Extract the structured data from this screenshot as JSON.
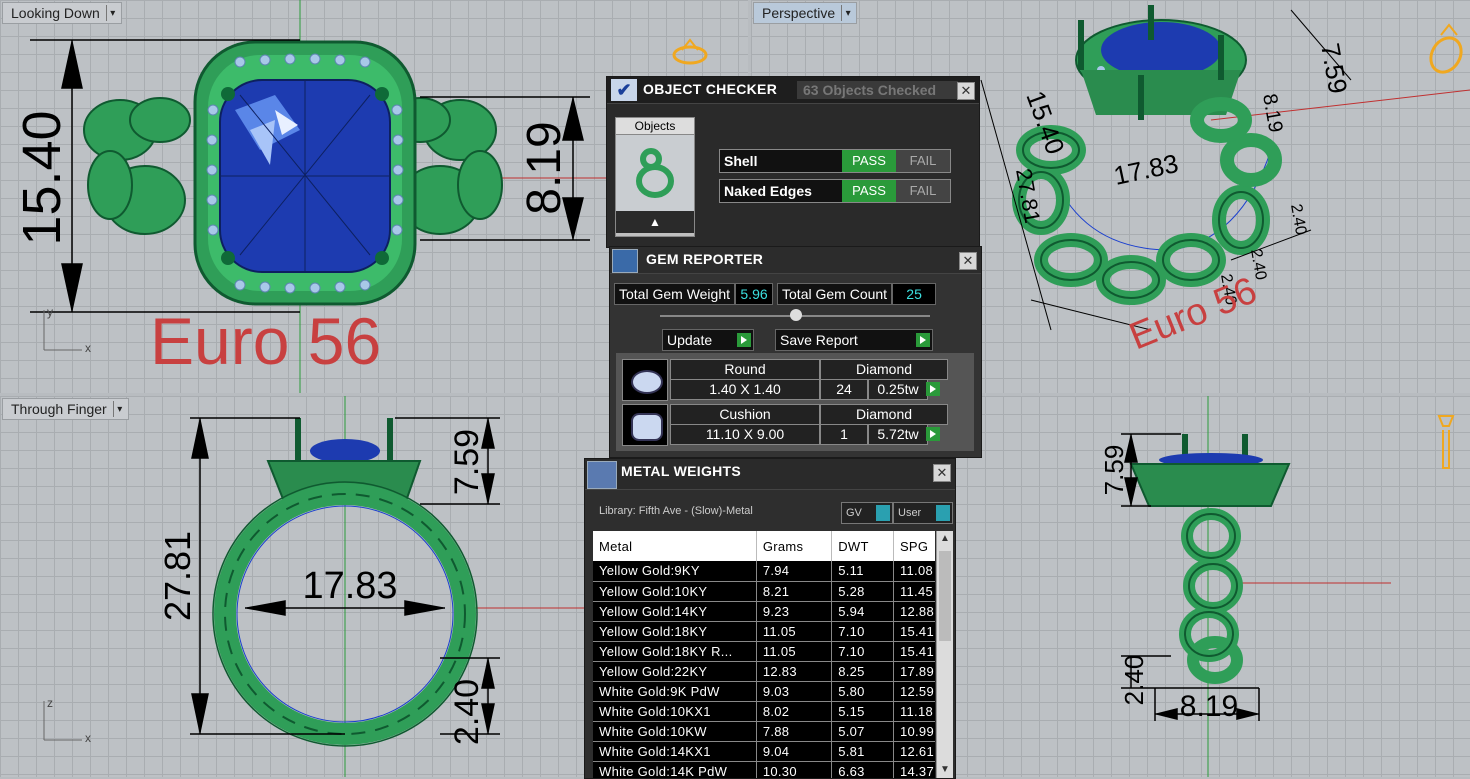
{
  "viewports": {
    "top": {
      "label": "Looking Down",
      "dim_vertical": "15.40",
      "dim_small": "8.19",
      "size_text": "Euro 56",
      "axis_y": "y",
      "axis_x": "x"
    },
    "perspective": {
      "label": "Perspective",
      "dims": [
        "7.59",
        "15.40",
        "17.83",
        "8.19",
        "2.40",
        "2.40",
        "27.81",
        "2.40"
      ],
      "size_text": "Euro 56"
    },
    "front": {
      "label": "Through Finger",
      "dim_height": "27.81",
      "dim_top": "7.59",
      "dim_inner": "17.83",
      "dim_bottom": "2.40",
      "axis_z": "z",
      "axis_x": "x"
    },
    "side": {
      "dim_top": "7.59",
      "dim_bottom": "2.40",
      "dim_width": "8.19"
    }
  },
  "object_checker": {
    "title": "OBJECT CHECKER",
    "status": "63  Objects Checked",
    "objects_label": "Objects",
    "checks": [
      {
        "name": "Shell",
        "pass": "PASS",
        "fail": "FAIL"
      },
      {
        "name": "Naked Edges",
        "pass": "PASS",
        "fail": "FAIL"
      }
    ]
  },
  "gem_reporter": {
    "title": "GEM REPORTER",
    "total_weight_label": "Total Gem Weight",
    "total_weight_value": "5.96",
    "total_count_label": "Total Gem Count",
    "total_count_value": "25",
    "update_label": "Update",
    "save_label": "Save Report",
    "gems": [
      {
        "shape": "Round",
        "material": "Diamond",
        "size": "1.40 X 1.40",
        "count": "24",
        "weight": "0.25tw"
      },
      {
        "shape": "Cushion",
        "material": "Diamond",
        "size": "11.10 X 9.00",
        "count": "1",
        "weight": "5.72tw"
      }
    ]
  },
  "metal_weights": {
    "title": "METAL WEIGHTS",
    "library": "Library: Fifth Ave - (Slow)-Metal",
    "gv_label": "GV",
    "user_label": "User",
    "columns": [
      "Metal",
      "Grams",
      "DWT",
      "SPG"
    ],
    "rows": [
      {
        "metal": "Yellow Gold:9KY",
        "grams": "7.94",
        "dwt": "5.11",
        "spg": "11.08"
      },
      {
        "metal": "Yellow Gold:10KY",
        "grams": "8.21",
        "dwt": "5.28",
        "spg": "11.45"
      },
      {
        "metal": "Yellow Gold:14KY",
        "grams": "9.23",
        "dwt": "5.94",
        "spg": "12.88"
      },
      {
        "metal": "Yellow Gold:18KY",
        "grams": "11.05",
        "dwt": "7.10",
        "spg": "15.41"
      },
      {
        "metal": "Yellow Gold:18KY R...",
        "grams": "11.05",
        "dwt": "7.10",
        "spg": "15.41"
      },
      {
        "metal": "Yellow Gold:22KY",
        "grams": "12.83",
        "dwt": "8.25",
        "spg": "17.89"
      },
      {
        "metal": "White Gold:9K PdW",
        "grams": "9.03",
        "dwt": "5.80",
        "spg": "12.59"
      },
      {
        "metal": "White Gold:10KX1",
        "grams": "8.02",
        "dwt": "5.15",
        "spg": "11.18"
      },
      {
        "metal": "White Gold:10KW",
        "grams": "7.88",
        "dwt": "5.07",
        "spg": "10.99"
      },
      {
        "metal": "White Gold:14KX1",
        "grams": "9.04",
        "dwt": "5.81",
        "spg": "12.61"
      },
      {
        "metal": "White Gold:14K PdW",
        "grams": "10.30",
        "dwt": "6.63",
        "spg": "14.37"
      }
    ]
  },
  "colors": {
    "ring_green": "#2e9a5a",
    "gem_blue": "#1a3fb0",
    "melee": "#a8c8e8",
    "pass_green": "#2a9a3a",
    "euro_red": "#c84040"
  }
}
